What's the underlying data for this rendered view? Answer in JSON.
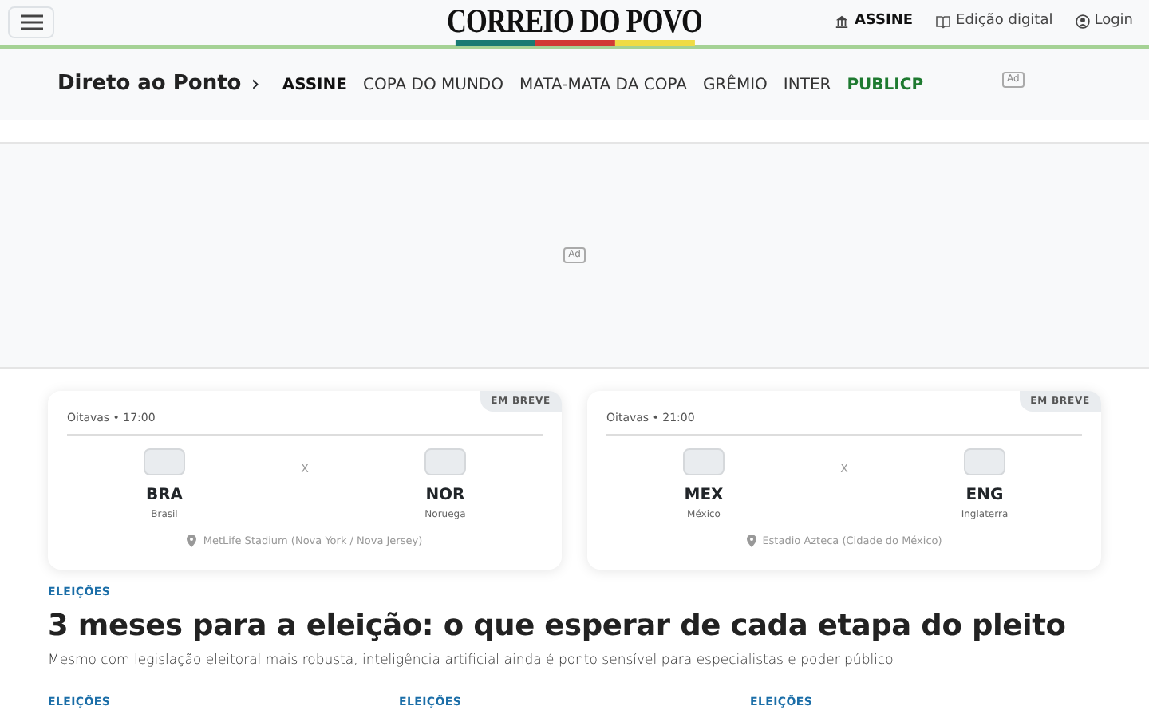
{
  "header": {
    "logo": "CORREIO DO POVO",
    "links": [
      {
        "label": "ASSINE",
        "kind": "subscribe"
      },
      {
        "label": "Edição digital",
        "kind": "edition"
      },
      {
        "label": "Login",
        "kind": "login"
      }
    ]
  },
  "subnav": {
    "title": "Direto ao Ponto",
    "chevron": "›",
    "items": [
      {
        "label": "ASSINE",
        "kind": "bold"
      },
      {
        "label": "COPA DO MUNDO",
        "kind": "plain"
      },
      {
        "label": "MATA-MATA DA COPA",
        "kind": "plain"
      },
      {
        "label": "GRÊMIO",
        "kind": "plain"
      },
      {
        "label": "INTER",
        "kind": "plain"
      },
      {
        "label": "PUBLICP",
        "kind": "highlight"
      }
    ],
    "ad_label": "Ad"
  },
  "ad_banner": {
    "label": "Ad"
  },
  "matches": [
    {
      "badge": "EM BREVE",
      "stage": "Oitavas • 17:00",
      "home": {
        "code": "BRA",
        "name": "Brasil"
      },
      "separator": "X",
      "away": {
        "code": "NOR",
        "name": "Noruega"
      },
      "venue": "MetLife Stadium (Nova York / Nova Jersey)"
    },
    {
      "badge": "EM BREVE",
      "stage": "Oitavas • 21:00",
      "home": {
        "code": "MEX",
        "name": "México"
      },
      "separator": "X",
      "away": {
        "code": "ENG",
        "name": "Inglaterra"
      },
      "venue": "Estadio Azteca (Cidade do México)"
    }
  ],
  "lead_story": {
    "tag": "ELEIÇÕES",
    "headline": "3 meses para a eleição: o que esperar de cada etapa do pleito",
    "summary": "Mesmo com legislação eleitoral mais robusta, inteligência artificial ainda é ponto sensível para especialistas e poder público"
  },
  "more_tags": [
    "ELEIÇÕES",
    "ELEIÇÕES",
    "ELEIÇÕES"
  ]
}
